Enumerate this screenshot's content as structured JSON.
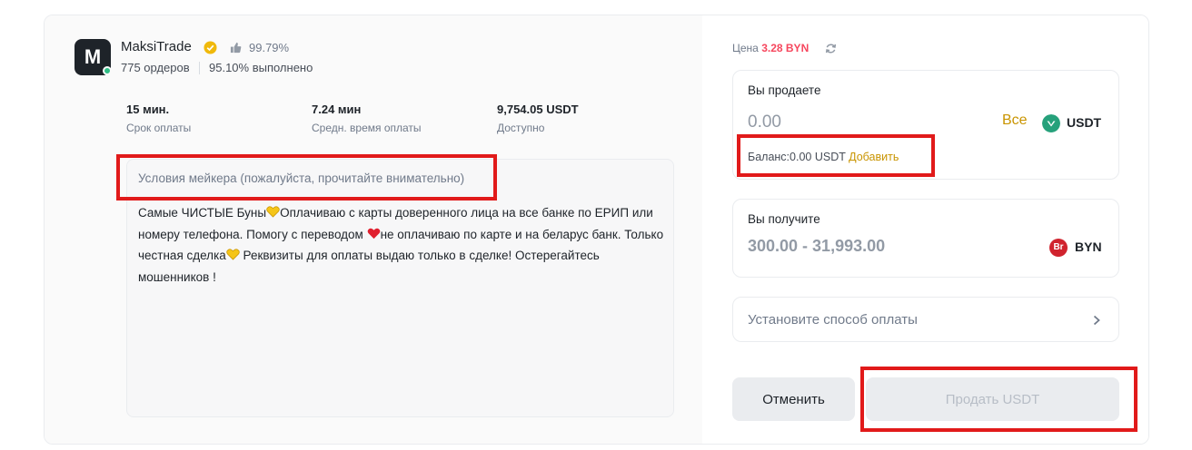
{
  "maker": {
    "avatar_letter": "M",
    "name": "MaksiTrade",
    "rating": "99.79%",
    "orders": "775 ордеров",
    "completion": "95.10% выполнено"
  },
  "stats": [
    {
      "value": "15 мин.",
      "label": "Срок оплаты"
    },
    {
      "value": "7.24 мин",
      "label": "Средн. время оплаты"
    },
    {
      "value": "9,754.05 USDT",
      "label": "Доступно"
    }
  ],
  "terms": {
    "title": "Условия мейкера (пожалуйста, прочитайте внимательно)",
    "part1": "Самые ЧИСТЫЕ Буны",
    "part2": "Оплачиваю с карты доверенного лица на все банке по ЕРИП или номеру телефона. Помогу с переводом ",
    "part3": "не оплачиваю по карте и на беларус банк. Только честная сделка",
    "part4": " Реквизиты для оплаты выдаю только в сделке! Остерегайтесь мошенников !"
  },
  "price": {
    "label": "Цена",
    "value": "3.28 BYN"
  },
  "sell": {
    "title": "Вы продаете",
    "placeholder": "0.00",
    "all_label": "Все",
    "currency": "USDT",
    "balance_label": "Баланс:0.00 USDT",
    "add_label": "Добавить"
  },
  "receive": {
    "title": "Вы получите",
    "range": "300.00 - 31,993.00",
    "currency_badge": "Br",
    "currency": "BYN"
  },
  "payment": {
    "label": "Установите способ оплаты"
  },
  "buttons": {
    "cancel": "Отменить",
    "sell": "Продать USDT"
  },
  "colors": {
    "accent": "#c99400",
    "price_red": "#f6465d",
    "highlight_box": "#e11a1a",
    "usdt": "#26a17b",
    "byn_badge": "#d0232e",
    "online": "#2ebd85"
  },
  "icons": [
    "verified-icon",
    "thumbs-up-icon",
    "refresh-icon",
    "usdt-coin-icon",
    "byn-coin-icon",
    "chevron-right-icon",
    "yellow-heart-icon",
    "red-heart-icon"
  ]
}
